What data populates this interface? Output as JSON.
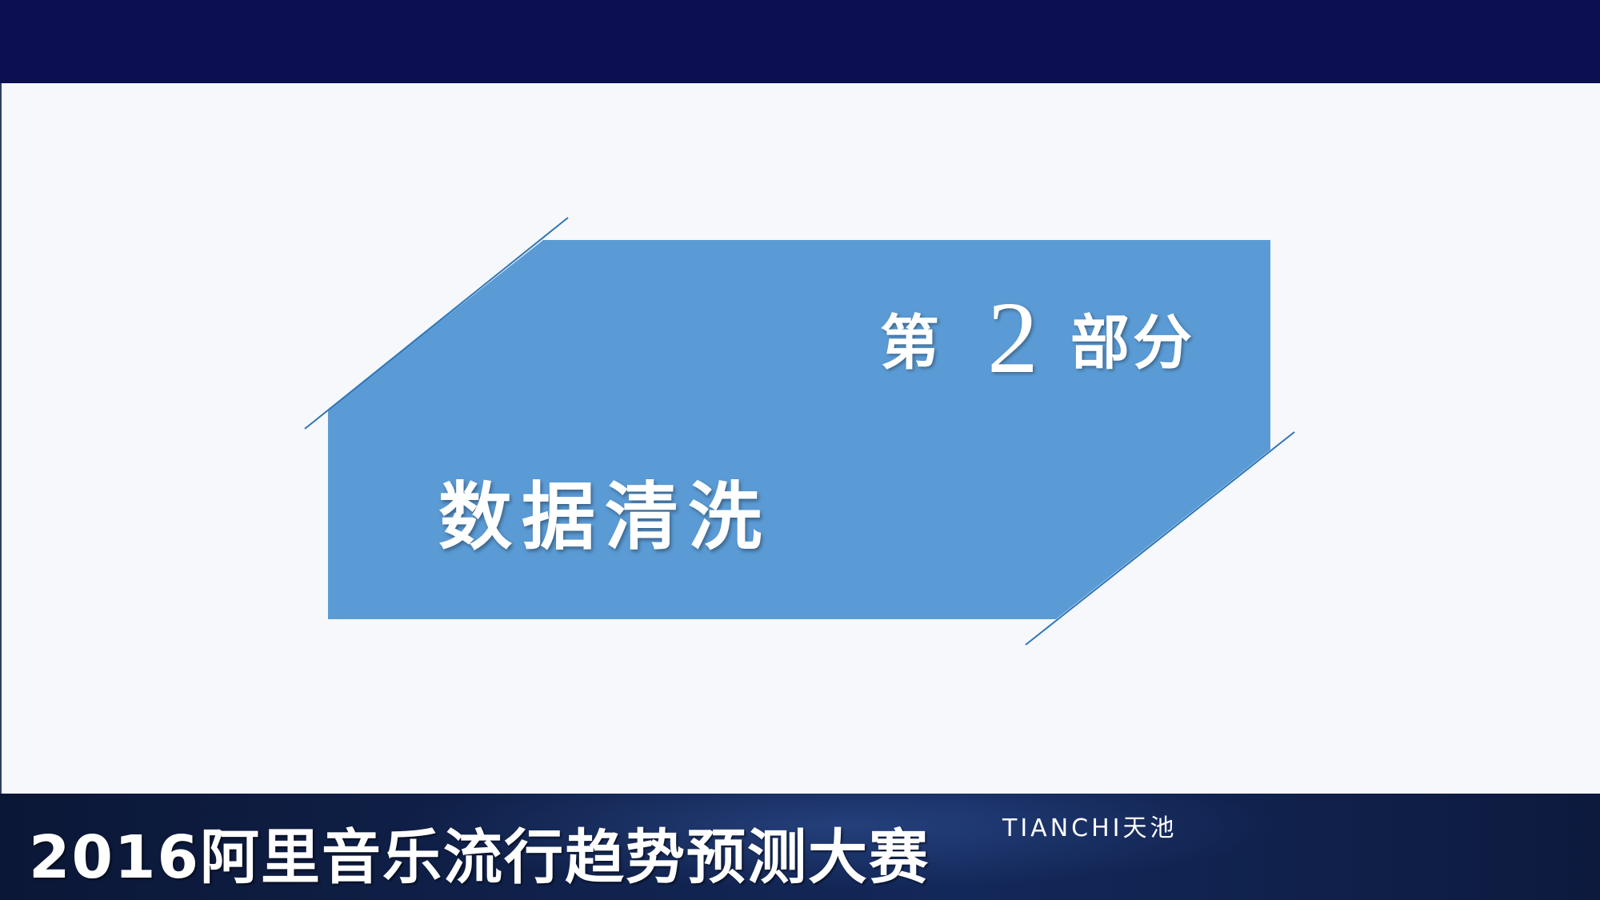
{
  "slide": {
    "section_word_prefix": "第",
    "section_number": "2",
    "section_word_suffix": "部分",
    "section_title": "数据清洗"
  },
  "footer": {
    "event_title": "2016阿里音乐流行趋势预测大赛",
    "brand_logo": "TIANCHI天池"
  },
  "colors": {
    "top_bar": "#0c0f52",
    "panel": "#5b9bd5",
    "accent_line": "#2e75b6",
    "background": "#f6f8fc",
    "footer": "#10214b"
  }
}
